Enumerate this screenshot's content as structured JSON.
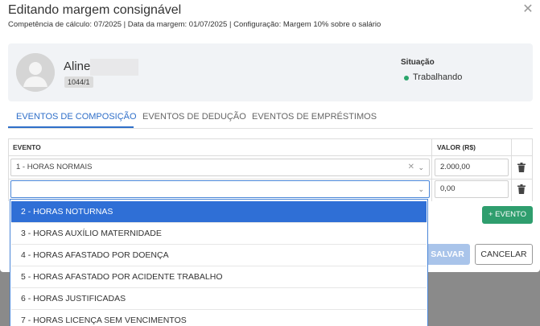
{
  "modal": {
    "title": "Editando margem consignável",
    "subtitle": "Competência de cálculo: 07/2025 | Data da margem: 01/07/2025 | Configuração: Margem 10% sobre o salário",
    "close_glyph": "✕"
  },
  "profile": {
    "name": "Aline",
    "id": "1044/1",
    "status_label": "Situação",
    "status_value": "Trabalhando",
    "status_color": "#2aa56b"
  },
  "tabs": [
    {
      "label": "EVENTOS DE COMPOSIÇÃO",
      "active": true
    },
    {
      "label": "EVENTOS DE DEDUÇÃO",
      "active": false
    },
    {
      "label": "EVENTOS DE EMPRÉSTIMOS",
      "active": false
    }
  ],
  "table": {
    "headers": {
      "evento": "EVENTO",
      "valor": "VALOR (R$)"
    },
    "rows": [
      {
        "evento": "1 - HORAS NORMAIS",
        "valor": "2.000,00"
      },
      {
        "evento": "",
        "valor": "0,00"
      }
    ]
  },
  "buttons": {
    "add_event": "+ EVENTO",
    "save": "SALVAR",
    "cancel": "CANCELAR"
  },
  "dropdown": {
    "options": [
      {
        "label": "2 - HORAS NOTURNAS",
        "selected": true
      },
      {
        "label": "3 - HORAS AUXÍLIO MATERNIDADE",
        "selected": false
      },
      {
        "label": "4 - HORAS AFASTADO POR DOENÇA",
        "selected": false
      },
      {
        "label": "5 - HORAS AFASTADO POR ACIDENTE TRABALHO",
        "selected": false
      },
      {
        "label": "6 - HORAS JUSTIFICADAS",
        "selected": false
      },
      {
        "label": "7 - HORAS LICENÇA SEM VENCIMENTOS",
        "selected": false
      }
    ]
  },
  "colors": {
    "accent": "#2f6fc9",
    "add_button": "#2f9e6e",
    "save_button_disabled": "#a9c4ea",
    "dropdown_selected": "#2f6fd6"
  },
  "icons": [
    "close-icon",
    "user-silhouette-icon",
    "status-dot-icon",
    "clear-icon",
    "chevron-down-icon",
    "trash-icon"
  ]
}
